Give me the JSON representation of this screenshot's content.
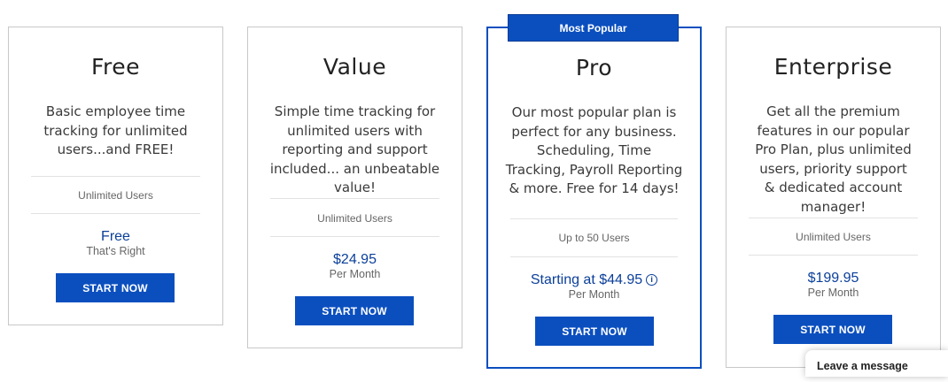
{
  "plans": [
    {
      "name": "Free",
      "description": "Basic employee time tracking for unlimited users...and FREE!",
      "users": "Unlimited Users",
      "price": "Free",
      "period": "That's Right",
      "button": "START NOW"
    },
    {
      "name": "Value",
      "description": "Simple time tracking for unlimited users with reporting and support included... an unbeatable value!",
      "users": "Unlimited Users",
      "price": "$24.95",
      "period": "Per Month",
      "button": "START NOW"
    },
    {
      "name": "Pro",
      "badge": "Most Popular",
      "description": "Our most popular plan is perfect for any business. Scheduling, Time Tracking, Payroll Reporting & more. Free for 14 days!",
      "users": "Up to 50 Users",
      "price": "Starting at $44.95",
      "price_info_icon": "info-circle-icon",
      "period": "Per Month",
      "button": "START NOW"
    },
    {
      "name": "Enterprise",
      "description": "Get all the premium features in our popular Pro Plan, plus unlimited users, priority support & dedicated account manager!",
      "users": "Unlimited Users",
      "price": "$199.95",
      "period": "Per Month",
      "button": "START NOW"
    }
  ],
  "chat": {
    "label": "Leave a message"
  },
  "colors": {
    "accent": "#0b4fbf",
    "price_text": "#0b3f9a",
    "border": "#c8c8c8"
  }
}
